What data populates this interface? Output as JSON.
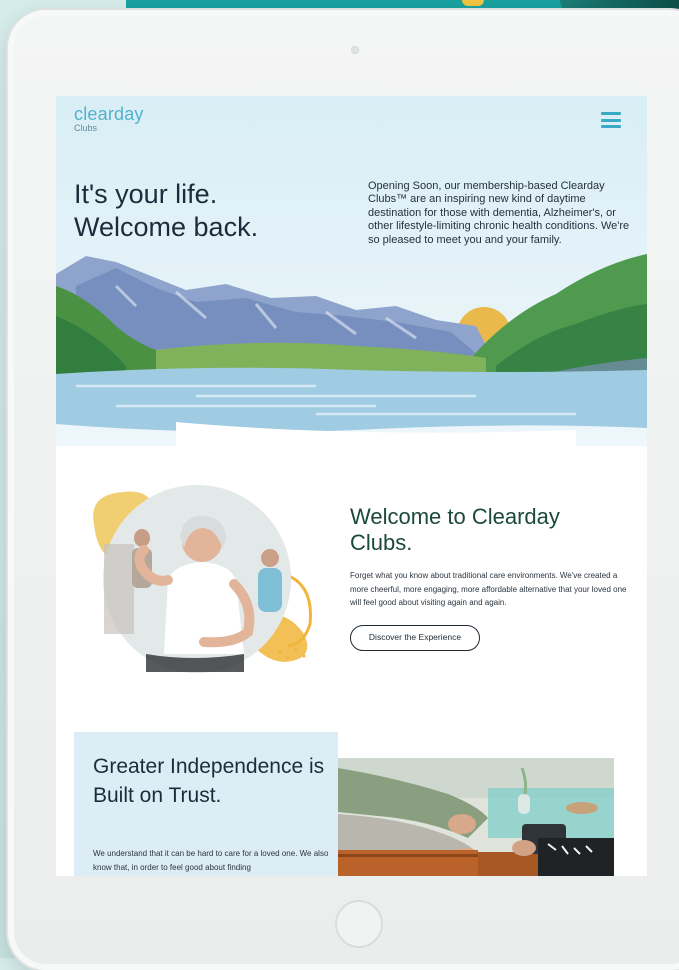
{
  "brand": {
    "name": "clearday",
    "sub": "Clubs"
  },
  "hero": {
    "headline_line1": "It's your life.",
    "headline_line2": "Welcome back.",
    "intro": "Opening Soon, our membership-based Clearday Clubs™ are an inspiring new kind of daytime destination for those with dementia, Alzheimer's, or other lifestyle-limiting chronic health conditions. We're so pleased to meet you and your family."
  },
  "welcome": {
    "title": "Welcome to Clearday Clubs.",
    "text": "Forget what you know about traditional care environments. We've created a more cheerful, more engaging, more affordable alternative that your loved one will feel good about visiting again and again.",
    "cta_label": "Discover the Experience"
  },
  "trust": {
    "title": "Greater Independence is Built on Trust.",
    "text": "We understand that it can be hard to care for a loved one. We also know that, in order to feel good about finding"
  },
  "icons": {
    "menu": "hamburger-menu-icon"
  },
  "colors": {
    "accent": "#52b1cc",
    "heading_green": "#1b4a37",
    "panel_blue": "#dcedf6",
    "backdrop_teal": "#1aa1a0"
  }
}
